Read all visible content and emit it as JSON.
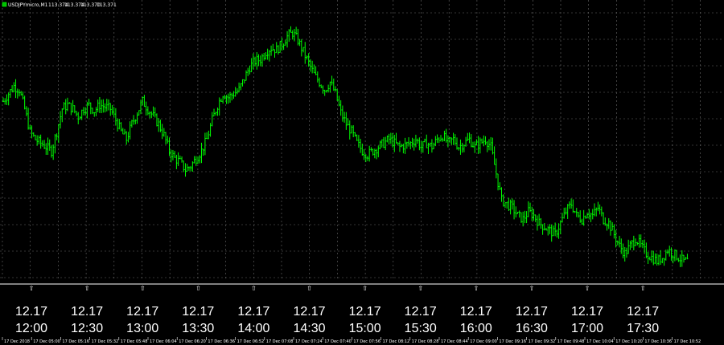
{
  "header": {
    "symbol_label": "USDJPYmicro,M1",
    "ohlc": [
      "113.374",
      "113.374",
      "113.370",
      "113.371"
    ]
  },
  "sessions": [
    {
      "date": "12.17",
      "time": "12:00"
    },
    {
      "date": "12.17",
      "time": "12:30"
    },
    {
      "date": "12.17",
      "time": "13:00"
    },
    {
      "date": "12.17",
      "time": "13:30"
    },
    {
      "date": "12.17",
      "time": "14:00"
    },
    {
      "date": "12.17",
      "time": "14:30"
    },
    {
      "date": "12.17",
      "time": "15:00"
    },
    {
      "date": "12.17",
      "time": "15:30"
    },
    {
      "date": "12.17",
      "time": "16:00"
    },
    {
      "date": "12.17",
      "time": "16:30"
    },
    {
      "date": "12.17",
      "time": "17:00"
    },
    {
      "date": "12.17",
      "time": "17:30"
    }
  ],
  "arrow_glyph": "⇧",
  "colors": {
    "background": "#000000",
    "candle": "#00ff00",
    "grid": "#6a6a6a",
    "text": "#ffffff"
  },
  "chart_data": {
    "type": "line",
    "title": "USDJPYmicro,M1",
    "grid": true,
    "x_tick_labels": [
      "17 Dec 2018",
      "17 Dec 05:00",
      "17 Dec 05:16",
      "17 Dec 05:32",
      "17 Dec 05:48",
      "17 Dec 06:04",
      "17 Dec 06:20",
      "17 Dec 06:36",
      "17 Dec 06:52",
      "17 Dec 07:08",
      "17 Dec 07:24",
      "17 Dec 07:40",
      "17 Dec 07:56",
      "17 Dec 08:12",
      "17 Dec 08:28",
      "17 Dec 08:44",
      "17 Dec 09:00",
      "17 Dec 09:16",
      "17 Dec 09:32",
      "17 Dec 09:48",
      "17 Dec 10:04",
      "17 Dec 10:20",
      "17 Dec 10:36",
      "17 Dec 10:52"
    ],
    "series": [
      {
        "values": [
          0.82,
          0.86,
          0.9,
          0.88,
          0.78,
          0.66,
          0.62,
          0.6,
          0.58,
          0.56,
          0.66,
          0.78,
          0.8,
          0.78,
          0.74,
          0.78,
          0.8,
          0.77,
          0.8,
          0.79,
          0.78,
          0.72,
          0.66,
          0.62,
          0.7,
          0.76,
          0.82,
          0.78,
          0.74,
          0.7,
          0.64,
          0.56,
          0.52,
          0.5,
          0.46,
          0.48,
          0.52,
          0.56,
          0.62,
          0.72,
          0.8,
          0.86,
          0.84,
          0.86,
          0.88,
          0.94,
          1.0,
          1.03,
          1.04,
          1.08,
          1.1,
          1.09,
          1.12,
          1.16,
          1.18,
          1.14,
          1.08,
          1.02,
          0.96,
          0.92,
          0.88,
          0.92,
          0.86,
          0.76,
          0.7,
          0.66,
          0.6,
          0.56,
          0.54,
          0.56,
          0.58,
          0.6,
          0.62,
          0.6,
          0.58,
          0.59,
          0.6,
          0.62,
          0.58,
          0.6,
          0.58,
          0.62,
          0.64,
          0.6,
          0.62,
          0.58,
          0.6,
          0.62,
          0.58,
          0.6,
          0.62,
          0.58,
          0.44,
          0.3,
          0.28,
          0.26,
          0.22,
          0.2,
          0.24,
          0.22,
          0.18,
          0.16,
          0.14,
          0.12,
          0.18,
          0.24,
          0.28,
          0.22,
          0.2,
          0.24,
          0.22,
          0.26,
          0.2,
          0.18,
          0.12,
          0.06,
          0.02,
          0.06,
          0.1,
          0.06,
          0.02,
          0.0,
          -0.02,
          0.0,
          0.04,
          0.02,
          0.0,
          -0.02
        ]
      }
    ]
  }
}
